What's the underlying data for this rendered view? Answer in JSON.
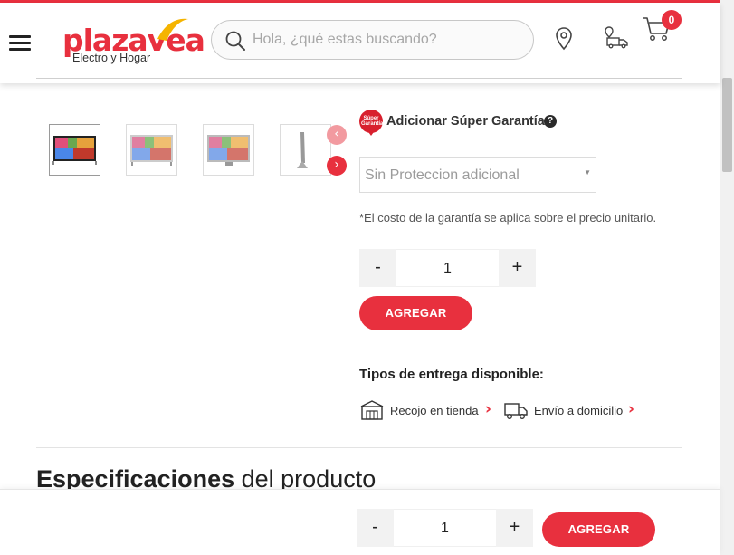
{
  "header": {
    "logo_word": "plazavea",
    "logo_sub": "Electro y Hogar",
    "search_placeholder": "Hola, ¿qué estas buscando?",
    "cart_count": "0"
  },
  "gallery": {
    "thumbnails": [
      "tv-front-thumbnail",
      "tv-front-thumbnail",
      "tv-front-thumbnail",
      "tv-side-thumbnail"
    ],
    "prev_label": "‹",
    "next_label": "›"
  },
  "warranty": {
    "badge_text": "Súper Garantía",
    "title": "Adicionar Súper Garantía",
    "help_label": "?",
    "select_value": "Sin Proteccion adicional",
    "note": "*El costo de la garantía se aplica sobre el precio unitario."
  },
  "quantity": {
    "minus": "-",
    "value": "1",
    "plus": "+"
  },
  "add_button": "AGREGAR",
  "delivery": {
    "title": "Tipos de entrega disponible:",
    "options": [
      {
        "label": "Recojo en tienda",
        "icon": "store-icon"
      },
      {
        "label": "Envío a domicilio",
        "icon": "delivery-truck-icon"
      }
    ]
  },
  "specs": {
    "title_bold": "Especificaciones",
    "title_rest": " del producto"
  },
  "sticky": {
    "minus": "-",
    "value": "1",
    "plus": "+",
    "add_button": "AGREGAR"
  },
  "colors": {
    "brand_red": "#e8303e",
    "dark_red": "#d8202e",
    "text": "#333333"
  }
}
